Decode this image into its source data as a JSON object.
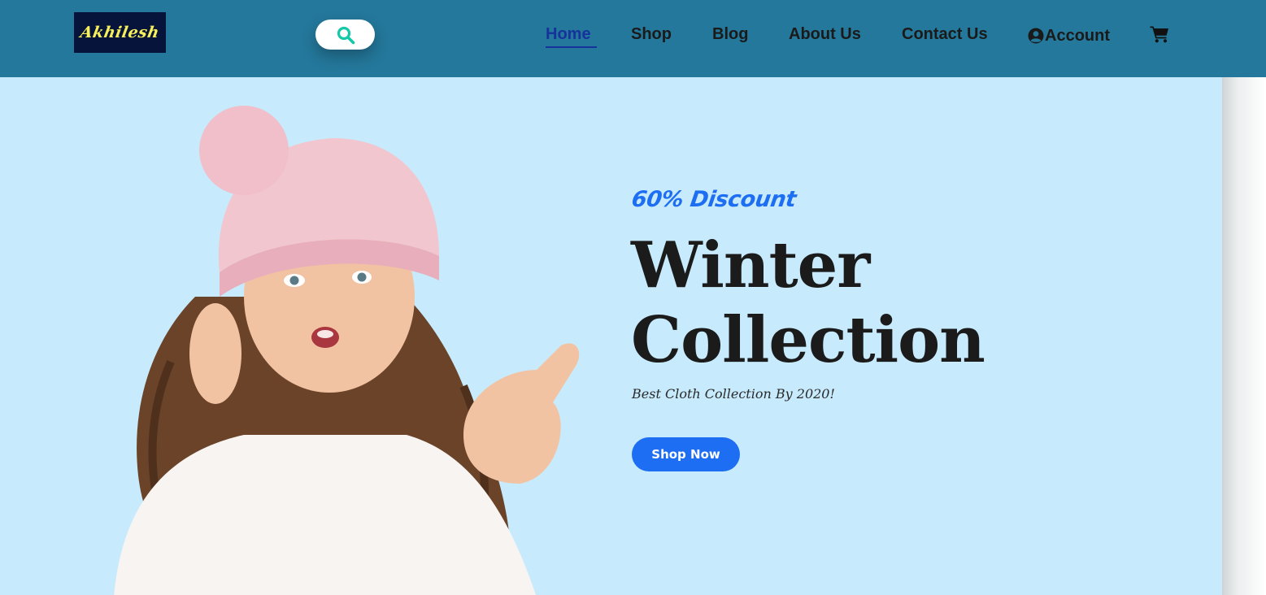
{
  "brand": {
    "logo_text": "Akhilesh"
  },
  "search": {
    "icon": "search-icon"
  },
  "nav": {
    "items": [
      {
        "label": "Home",
        "active": true
      },
      {
        "label": "Shop",
        "active": false
      },
      {
        "label": "Blog",
        "active": false
      },
      {
        "label": "About Us",
        "active": false
      },
      {
        "label": "Contact Us",
        "active": false
      }
    ],
    "account_label": "Account",
    "account_icon": "user-circle-icon",
    "cart_icon": "shopping-cart-icon"
  },
  "hero": {
    "discount": "60% Discount",
    "title_line1": "Winter",
    "title_line2": "Collection",
    "subtitle": "Best Cloth Collection By 2020!",
    "cta_label": "Shop Now",
    "image": "girl-in-pink-beanie-pointing"
  },
  "colors": {
    "navbar": "#24789b",
    "hero_bg": "#c7ebfc",
    "accent": "#1d6ef2",
    "active_link": "#16339c",
    "search_icon": "#14c8a8",
    "logo_bg": "#06133a",
    "logo_text": "#f7f05a"
  }
}
